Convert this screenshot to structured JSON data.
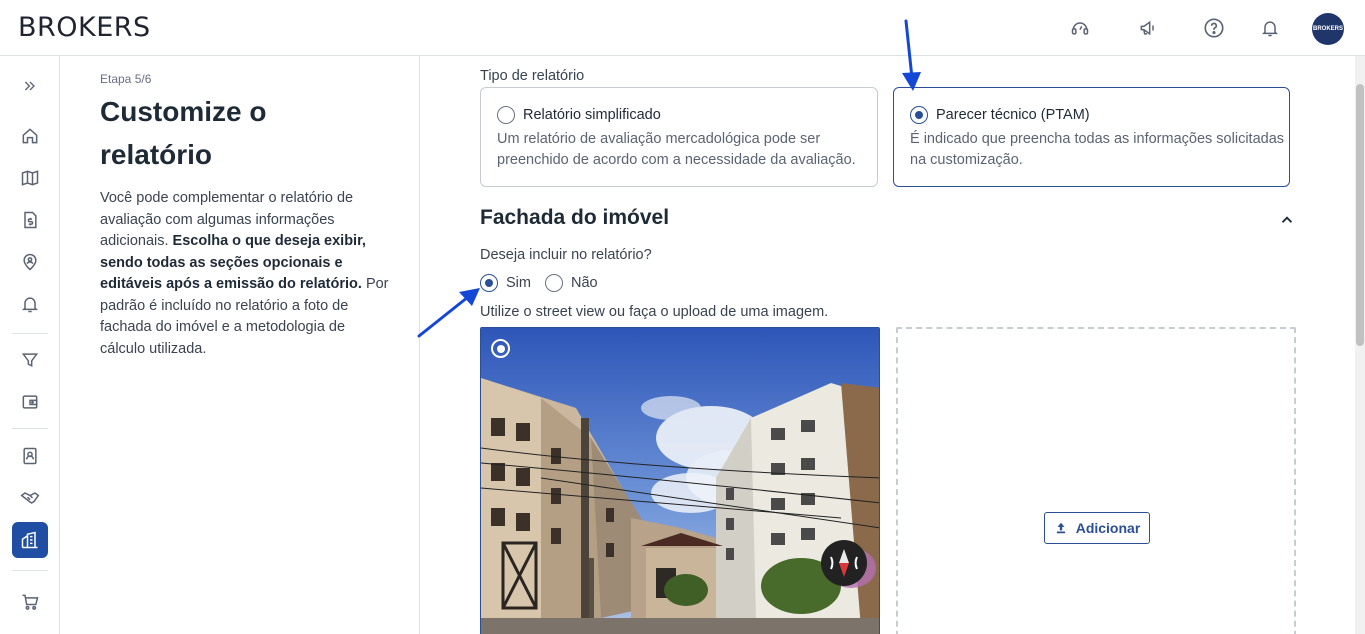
{
  "header": {
    "logo": "BROKERS",
    "icons": [
      "support-icon",
      "megaphone-icon",
      "help-icon",
      "bell-icon"
    ],
    "avatar_text": "BROKERS"
  },
  "sidebar": {
    "items": [
      "expand-icon",
      "home-icon",
      "map-icon",
      "document-dollar-icon",
      "location-person-icon",
      "bell-icon",
      "filter-icon",
      "wallet-icon",
      "contact-card-icon",
      "handshake-icon",
      "buildings-icon",
      "cart-icon"
    ],
    "active": "buildings-icon"
  },
  "info": {
    "step": "Etapa 5/6",
    "title": "Customize o relatório",
    "text_intro": "Você pode complementar o relatório de avaliação com algumas informações adicionais.",
    "text_bold": "Escolha o que deseja exibir, sendo todas as seções opcionais e editáveis após a emissão do relatório.",
    "text_outro": "Por padrão é incluído no relatório a foto de fachada do imóvel e a metodologia de cálculo utilizada."
  },
  "report": {
    "type_label": "Tipo de relatório",
    "options": [
      {
        "title": "Relatório simplificado",
        "desc": "Um relatório de avaliação mercadológica pode ser preenchido de acordo com a necessidade da avaliação.",
        "selected": false
      },
      {
        "title": "Parecer técnico (PTAM)",
        "desc": "É indicado que preencha todas as informações solicitadas na customização.",
        "selected": true
      }
    ]
  },
  "facade": {
    "title": "Fachada do imóvel",
    "question": "Deseja incluir no relatório?",
    "yes": "Sim",
    "no": "Não",
    "include": true,
    "hint": "Utilize o street view ou faça o upload de uma imagem.",
    "add_button": "Adicionar"
  },
  "colors": {
    "accent": "#2b4f96",
    "nav_active": "#1f4ea3",
    "annotation_arrow": "#1447d6"
  }
}
